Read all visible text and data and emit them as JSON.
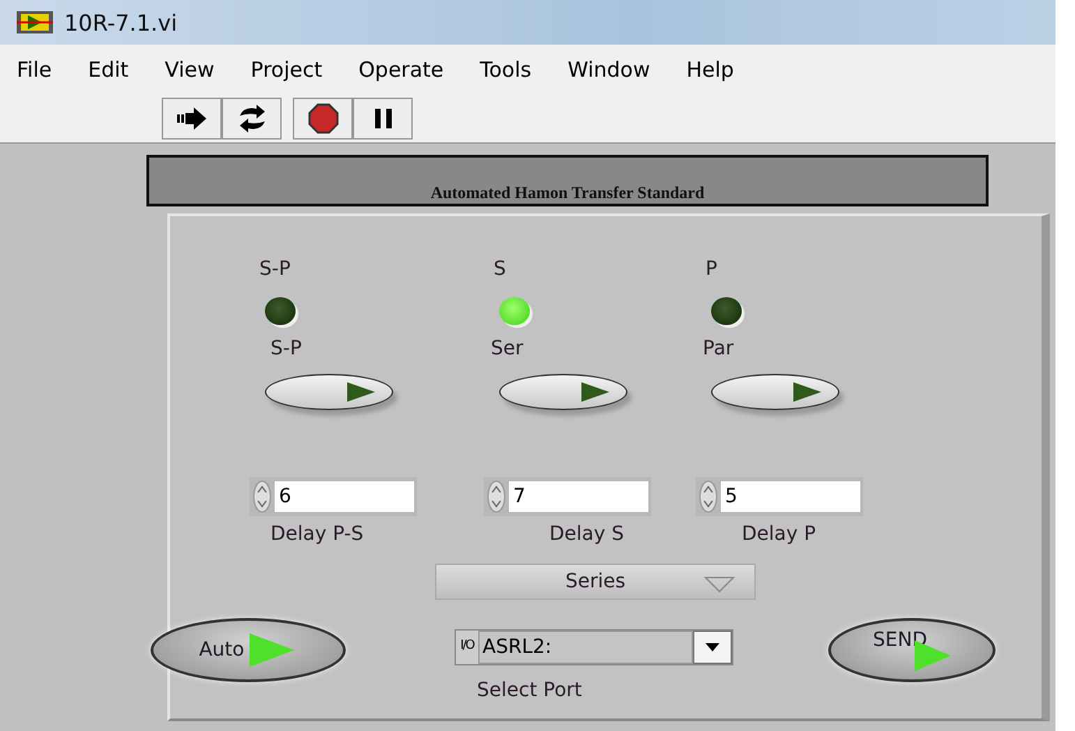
{
  "window": {
    "title": "10R-7.1.vi"
  },
  "menu": [
    "File",
    "Edit",
    "View",
    "Project",
    "Operate",
    "Tools",
    "Window",
    "Help"
  ],
  "banner": {
    "title": "Automated Hamon Transfer Standard"
  },
  "indicators": [
    {
      "label": "S-P",
      "on": false
    },
    {
      "label": "S",
      "on": true
    },
    {
      "label": "P",
      "on": false
    }
  ],
  "mode_buttons": [
    {
      "label": "S-P"
    },
    {
      "label": "Ser"
    },
    {
      "label": "Par"
    }
  ],
  "delays": [
    {
      "value": "6",
      "label": "Delay P-S"
    },
    {
      "value": "7",
      "label": "Delay S"
    },
    {
      "value": "5",
      "label": "Delay P"
    }
  ],
  "mode_ring": {
    "value": "Series"
  },
  "auto_button": {
    "label": "Auto"
  },
  "send_button": {
    "label": "SEND"
  },
  "port": {
    "prefix": "I/O",
    "value": "ASRL2:",
    "label": "Select Port"
  }
}
